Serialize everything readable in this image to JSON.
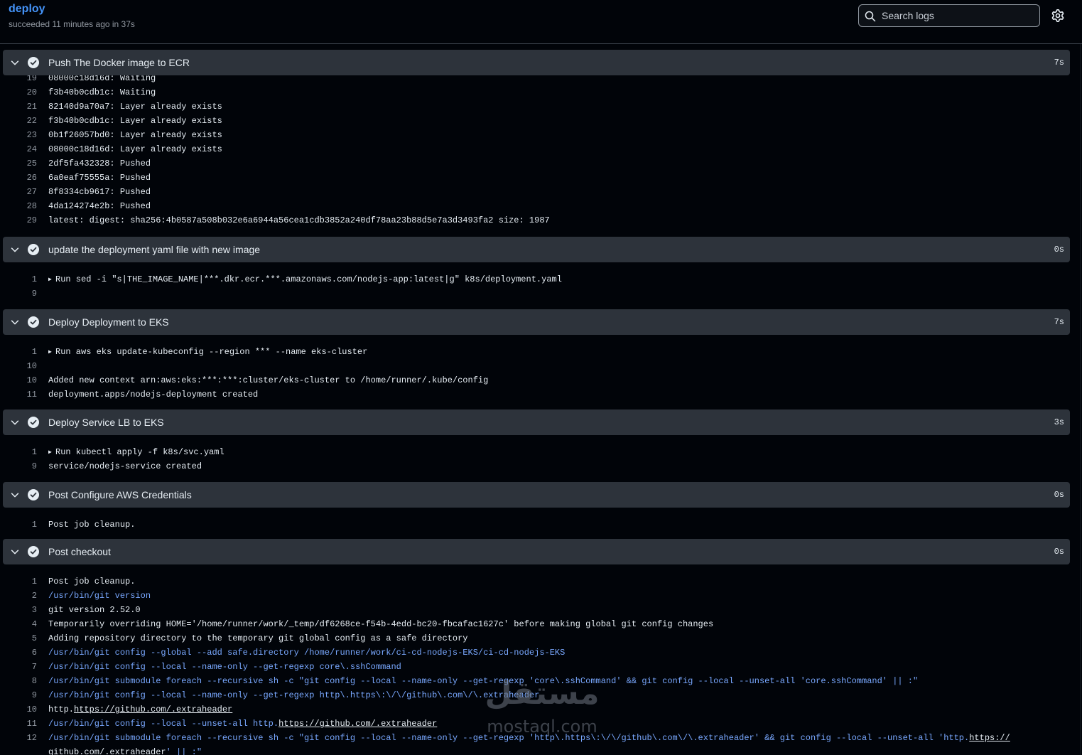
{
  "job": {
    "name": "deploy",
    "status": "succeeded 11 minutes ago in 37s"
  },
  "search": {
    "placeholder": "Search logs"
  },
  "icons": {
    "chevron": "chevron-down-icon",
    "check": "check-circle-icon",
    "settings": "gear-icon",
    "search": "search-icon"
  },
  "colors": {
    "link": "#4493f8",
    "command": "#79a8ff",
    "step_bg": "#2d333b",
    "background": "#010409"
  },
  "steps": [
    {
      "name": "Push The Docker image to ECR",
      "duration": "7s",
      "lines": [
        {
          "n": "19",
          "t": "08000c18d16d: Waiting"
        },
        {
          "n": "20",
          "t": "f3b40b0cdb1c: Waiting"
        },
        {
          "n": "21",
          "t": "82140d9a70a7: Layer already exists"
        },
        {
          "n": "22",
          "t": "f3b40b0cdb1c: Layer already exists"
        },
        {
          "n": "23",
          "t": "0b1f26057bd0: Layer already exists"
        },
        {
          "n": "24",
          "t": "08000c18d16d: Layer already exists"
        },
        {
          "n": "25",
          "t": "2df5fa432328: Pushed"
        },
        {
          "n": "26",
          "t": "6a0eaf75555a: Pushed"
        },
        {
          "n": "27",
          "t": "8f8334cb9617: Pushed"
        },
        {
          "n": "28",
          "t": "4da124274e2b: Pushed"
        },
        {
          "n": "29",
          "t": "latest: digest: sha256:4b0587a508b032e6a6944a56cea1cdb3852a240df78aa23b88d5e7a3d3493fa2 size: 1987"
        }
      ]
    },
    {
      "name": "update the deployment yaml file with new image",
      "duration": "0s",
      "lines": [
        {
          "n": "1",
          "t": "Run sed -i \"s|THE_IMAGE_NAME|***.dkr.ecr.***.amazonaws.com/nodejs-app:latest|g\" k8s/deployment.yaml",
          "group": true
        },
        {
          "n": "9",
          "t": ""
        }
      ]
    },
    {
      "name": "Deploy Deployment to EKS",
      "duration": "7s",
      "lines": [
        {
          "n": "1",
          "t": "Run aws eks update-kubeconfig --region *** --name eks-cluster",
          "group": true
        },
        {
          "n": "10",
          "t": ""
        },
        {
          "n": "10",
          "t": "Added new context arn:aws:eks:***:***:cluster/eks-cluster to /home/runner/.kube/config"
        },
        {
          "n": "11",
          "t": "deployment.apps/nodejs-deployment created"
        }
      ]
    },
    {
      "name": "Deploy Service LB to EKS",
      "duration": "3s",
      "lines": [
        {
          "n": "1",
          "t": "Run kubectl apply -f k8s/svc.yaml",
          "group": true
        },
        {
          "n": "9",
          "t": "service/nodejs-service created"
        }
      ]
    },
    {
      "name": "Post Configure AWS Credentials",
      "duration": "0s",
      "lines": [
        {
          "n": "1",
          "t": "Post job cleanup."
        }
      ]
    },
    {
      "name": "Post checkout",
      "duration": "0s",
      "lines": [
        {
          "n": "1",
          "t": "Post job cleanup."
        },
        {
          "n": "2",
          "t": "/usr/bin/git version",
          "cmd": true
        },
        {
          "n": "3",
          "t": "git version 2.52.0"
        },
        {
          "n": "4",
          "t": "Temporarily overriding HOME='/home/runner/work/_temp/df6268ce-f54b-4edd-bc20-fbcafac1627c' before making global git config changes"
        },
        {
          "n": "5",
          "t": "Adding repository directory to the temporary git global config as a safe directory"
        },
        {
          "n": "6",
          "t": "/usr/bin/git config --global --add safe.directory /home/runner/work/ci-cd-nodejs-EKS/ci-cd-nodejs-EKS",
          "cmd": true
        },
        {
          "n": "7",
          "t": "/usr/bin/git config --local --name-only --get-regexp core\\.sshCommand",
          "cmd": true
        },
        {
          "n": "8",
          "t": "/usr/bin/git submodule foreach --recursive sh -c \"git config --local --name-only --get-regexp 'core\\.sshCommand' && git config --local --unset-all 'core.sshCommand' || :\"",
          "cmd": true
        },
        {
          "n": "9",
          "t": "/usr/bin/git config --local --name-only --get-regexp http\\.https\\:\\/\\/github\\.com\\/\\.extraheader",
          "cmd": true
        },
        {
          "n": "10",
          "t": "http.",
          "link": "https://github.com/.extraheader"
        },
        {
          "n": "11",
          "t": "/usr/bin/git config --local --unset-all http.",
          "link": "https://github.com/.extraheader",
          "cmd": true
        },
        {
          "n": "12",
          "t": "/usr/bin/git submodule foreach --recursive sh -c \"git config --local --name-only --get-regexp 'http\\.https\\:\\/\\/github\\.com\\/\\.extraheader' && git config --local --unset-all 'http.",
          "link": "https://",
          "cmd": true
        },
        {
          "n": "",
          "t": "",
          "link": "github.com/.extraheader",
          "tail": "' || :\"",
          "cmd": true
        }
      ]
    }
  ],
  "watermark": {
    "arabic": "مستقل",
    "latin": "mostaql.com"
  }
}
